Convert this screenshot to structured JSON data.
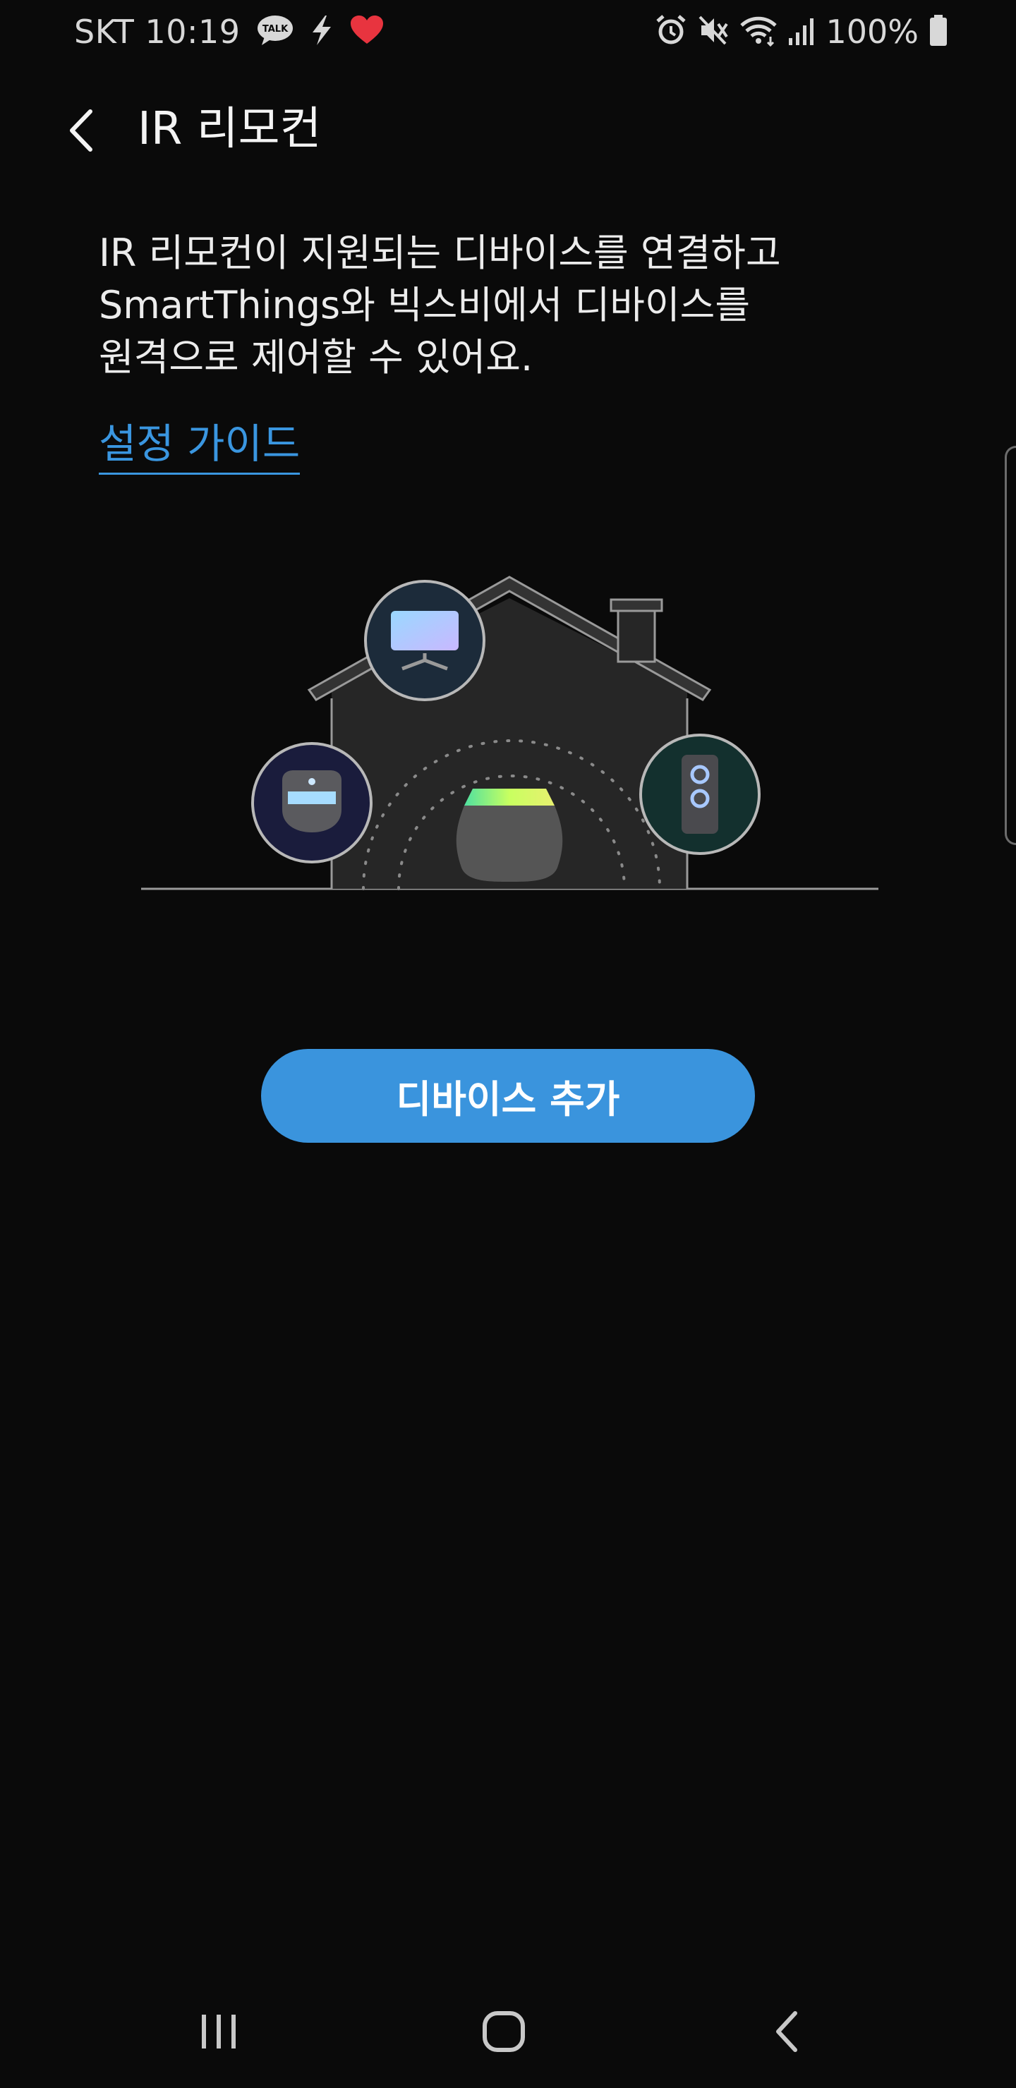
{
  "status_bar": {
    "carrier_time": "SKT 10:19",
    "battery_percent": "100%",
    "left_icons": [
      "kakaotalk-icon",
      "lightning-icon",
      "heart-icon"
    ],
    "right_icons": [
      "alarm-icon",
      "mute-icon",
      "wifi-icon",
      "signal-icon",
      "battery-icon"
    ]
  },
  "header": {
    "title": "IR 리모컨",
    "back_icon": "chevron-left-icon"
  },
  "description": {
    "line1": "IR 리모컨이 지원되는 디바이스를 연결하고",
    "line2": "SmartThings와 빅스비에서 디바이스를",
    "line3": "원격으로 제어할 수 있어요."
  },
  "guide_link": "설정 가이드",
  "illustration": {
    "icons": [
      "house-icon",
      "tv-icon",
      "air-conditioner-icon",
      "speaker-icon",
      "smart-hub-icon"
    ]
  },
  "add_device_button": "디바이스 추가",
  "nav_bar": {
    "icons": [
      "recent-apps-icon",
      "home-icon",
      "back-icon"
    ]
  },
  "colors": {
    "background": "#0a0a0a",
    "accent": "#3a94dd",
    "link": "#3a96e0"
  }
}
